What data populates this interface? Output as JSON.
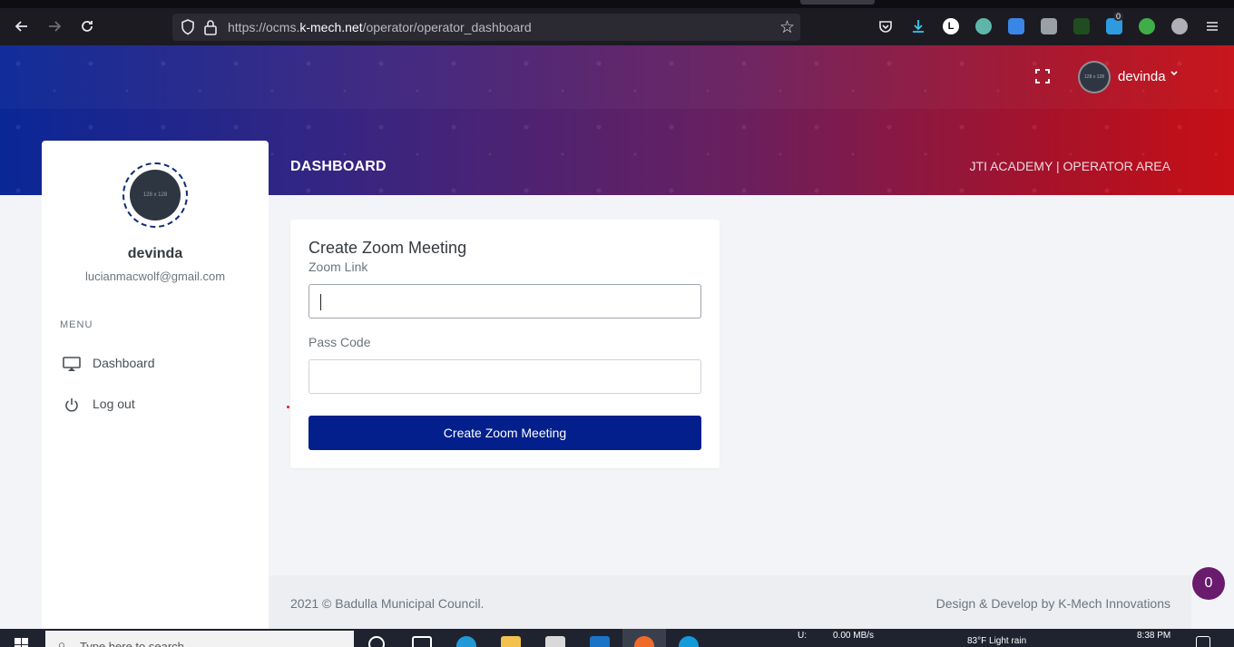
{
  "browser": {
    "url_prefix": "https://ocms.",
    "url_domain": "k-mech.net",
    "url_path": "/operator/operator_dashboard",
    "icons": [
      "back-icon",
      "forward-icon",
      "reload-icon",
      "shield-icon",
      "lock-icon",
      "bookmark-star-icon",
      "pocket-icon",
      "download-icon",
      "menu-icon"
    ],
    "extension_badge": "0"
  },
  "header": {
    "user_name": "devinda",
    "avatar_placeholder": "128 x 128",
    "page_title": "DASHBOARD",
    "area_title": "JTI ACADEMY | OPERATOR AREA"
  },
  "sidebar": {
    "avatar_placeholder": "128 x 128",
    "name": "devinda",
    "email": "lucianmacwolf@gmail.com",
    "menu_title": "MENU",
    "items": [
      {
        "label": "Dashboard",
        "icon": "monitor-icon"
      },
      {
        "label": "Log out",
        "icon": "power-icon"
      }
    ]
  },
  "form": {
    "title": "Create Zoom Meeting",
    "zoom_link_label": "Zoom Link",
    "zoom_link_value": "",
    "pass_code_label": "Pass Code",
    "pass_code_value": "",
    "submit_label": "Create Zoom Meeting",
    "submit_color": "#021f8c"
  },
  "footer": {
    "copyright": "2021 © Badulla Municipal Council.",
    "credit": "Design & Develop by K-Mech Innovations"
  },
  "notification": {
    "count": "0",
    "color": "#6b1b6e"
  },
  "taskbar": {
    "search_placeholder": "Type here to search",
    "network_label": "U:",
    "network_speed": "0.00 MB/s",
    "weather": "83°F  Light rain",
    "time": "8:38 PM"
  },
  "colors": {
    "header_gradient_start": "#0a2796",
    "header_gradient_end": "#c70f15"
  }
}
